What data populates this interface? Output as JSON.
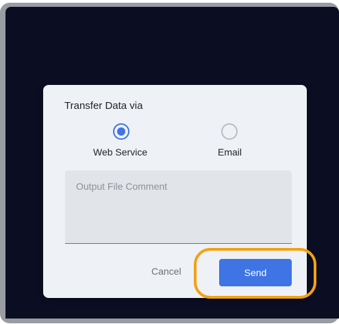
{
  "dialog": {
    "title": "Transfer Data via",
    "options": [
      {
        "label": "Web Service",
        "selected": true
      },
      {
        "label": "Email",
        "selected": false
      }
    ],
    "comment_placeholder": "Output File Comment",
    "cancel_label": "Cancel",
    "send_label": "Send"
  },
  "colors": {
    "accent": "#3f74e4",
    "highlight": "#f2a115",
    "screen_background": "#0b0e23"
  }
}
